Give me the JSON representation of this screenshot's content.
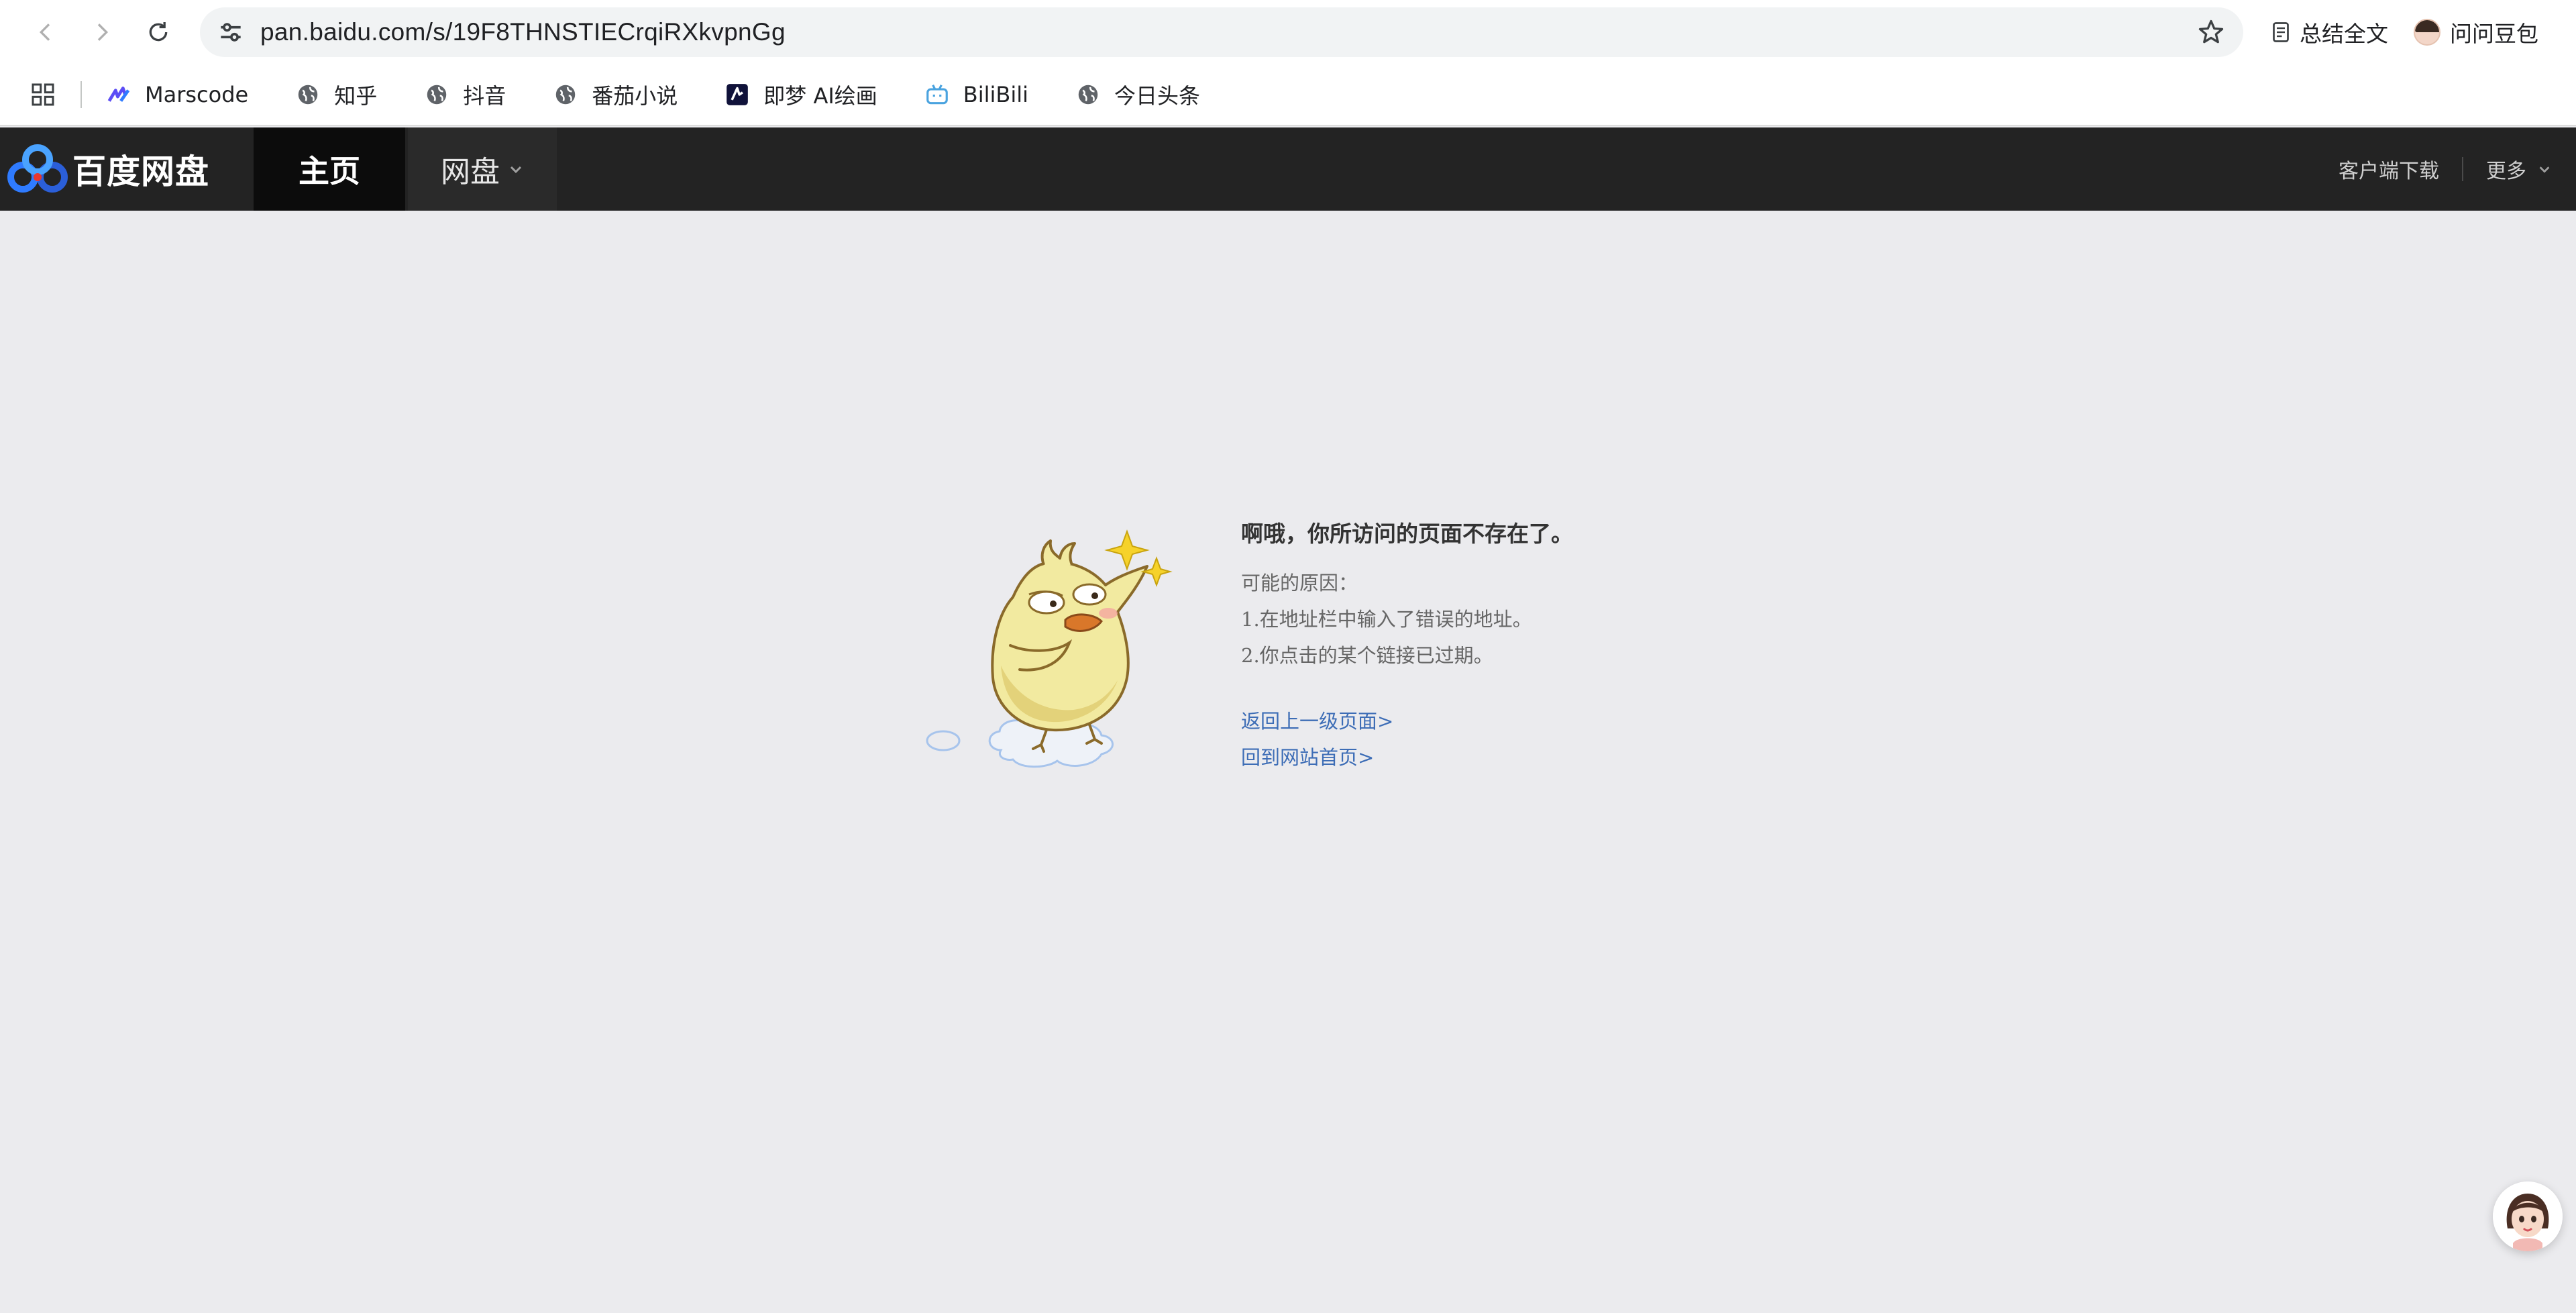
{
  "browser": {
    "url": "pan.baidu.com/s/19F8THNSTIECrqiRXkvpnGg",
    "actions": [
      {
        "label": "总结全文",
        "icon": "summary-icon"
      },
      {
        "label": "问问豆包",
        "icon": "doubao-avatar-icon"
      }
    ],
    "bookmarks": [
      {
        "label": "Marscode",
        "icon": "marscode-icon"
      },
      {
        "label": "知乎",
        "icon": "globe-icon"
      },
      {
        "label": "抖音",
        "icon": "globe-icon"
      },
      {
        "label": "番茄小说",
        "icon": "globe-icon"
      },
      {
        "label": "即梦 AI绘画",
        "icon": "jimeng-icon"
      },
      {
        "label": "BiliBili",
        "icon": "bilibili-icon"
      },
      {
        "label": "今日头条",
        "icon": "globe-icon"
      }
    ]
  },
  "site": {
    "logo_text": "百度网盘",
    "nav": {
      "home": "主页",
      "pan": "网盘"
    },
    "header_right": {
      "download": "客户端下载",
      "more": "更多"
    },
    "colors": {
      "header_bg": "#232323",
      "link": "#3d6db6",
      "page_bg": "#ebebee"
    }
  },
  "error": {
    "title": "啊哦，你所访问的页面不存在了。",
    "reason_label": "可能的原因：",
    "reasons": [
      "1.在地址栏中输入了错误的地址。",
      "2.你点击的某个链接已过期。"
    ],
    "links": {
      "back": "返回上一级页面>",
      "home": "回到网站首页>"
    }
  }
}
